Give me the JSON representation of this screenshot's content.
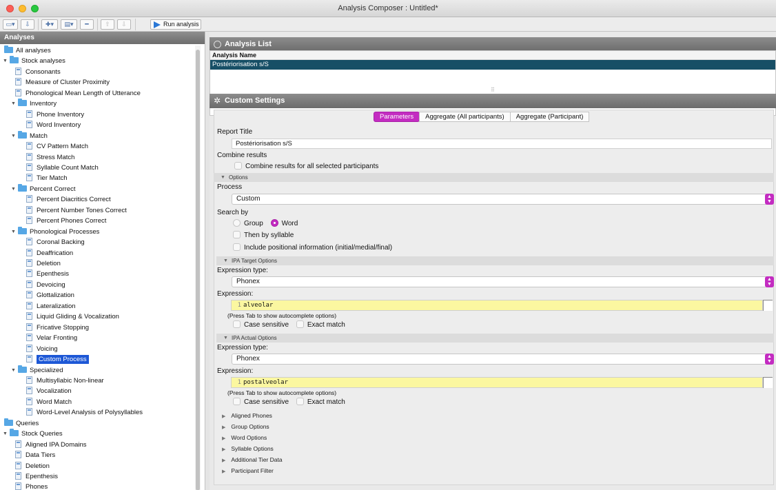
{
  "window": {
    "title": "Analysis Composer : Untitled*"
  },
  "toolbar": {
    "run_label": "Run analysis"
  },
  "left": {
    "header": "Analyses",
    "tree": [
      {
        "label": "All analyses",
        "kind": "folder",
        "level": 0,
        "expanded": false
      },
      {
        "label": "Stock analyses",
        "kind": "folder",
        "level": 1,
        "expanded": true
      },
      {
        "label": "Consonants",
        "kind": "doc",
        "level": 2
      },
      {
        "label": "Measure of Cluster Proximity",
        "kind": "doc",
        "level": 2
      },
      {
        "label": "Phonological Mean Length of Utterance",
        "kind": "doc",
        "level": 2
      },
      {
        "label": "Inventory",
        "kind": "folder",
        "level": 2,
        "expanded": true
      },
      {
        "label": "Phone Inventory",
        "kind": "doc",
        "level": 3
      },
      {
        "label": "Word Inventory",
        "kind": "doc",
        "level": 3
      },
      {
        "label": "Match",
        "kind": "folder",
        "level": 2,
        "expanded": true
      },
      {
        "label": "CV Pattern Match",
        "kind": "doc",
        "level": 3
      },
      {
        "label": "Stress Match",
        "kind": "doc",
        "level": 3
      },
      {
        "label": "Syllable Count Match",
        "kind": "doc",
        "level": 3
      },
      {
        "label": "Tier Match",
        "kind": "doc",
        "level": 3
      },
      {
        "label": "Percent Correct",
        "kind": "folder",
        "level": 2,
        "expanded": true
      },
      {
        "label": "Percent Diacritics Correct",
        "kind": "doc",
        "level": 3
      },
      {
        "label": "Percent Number Tones Correct",
        "kind": "doc",
        "level": 3
      },
      {
        "label": "Percent Phones Correct",
        "kind": "doc",
        "level": 3
      },
      {
        "label": "Phonological Processes",
        "kind": "folder",
        "level": 2,
        "expanded": true
      },
      {
        "label": "Coronal Backing",
        "kind": "doc",
        "level": 3
      },
      {
        "label": "Deaffrication",
        "kind": "doc",
        "level": 3
      },
      {
        "label": "Deletion",
        "kind": "doc",
        "level": 3
      },
      {
        "label": "Epenthesis",
        "kind": "doc",
        "level": 3
      },
      {
        "label": "Devoicing",
        "kind": "doc",
        "level": 3
      },
      {
        "label": "Glottalization",
        "kind": "doc",
        "level": 3
      },
      {
        "label": "Lateralization",
        "kind": "doc",
        "level": 3
      },
      {
        "label": "Liquid Gliding & Vocalization",
        "kind": "doc",
        "level": 3
      },
      {
        "label": "Fricative Stopping",
        "kind": "doc",
        "level": 3
      },
      {
        "label": "Velar Fronting",
        "kind": "doc",
        "level": 3
      },
      {
        "label": "Voicing",
        "kind": "doc",
        "level": 3
      },
      {
        "label": "Custom Process",
        "kind": "doc",
        "level": 3,
        "selected": true
      },
      {
        "label": "Specialized",
        "kind": "folder",
        "level": 2,
        "expanded": true
      },
      {
        "label": "Multisyllabic Non-linear",
        "kind": "doc",
        "level": 3
      },
      {
        "label": "Vocalization",
        "kind": "doc",
        "level": 3
      },
      {
        "label": "Word Match",
        "kind": "doc",
        "level": 3
      },
      {
        "label": "Word-Level Analysis of Polysyllables",
        "kind": "doc",
        "level": 3
      },
      {
        "label": "Queries",
        "kind": "folder",
        "level": 0,
        "expanded": false
      },
      {
        "label": "Stock Queries",
        "kind": "folder",
        "level": 1,
        "expanded": true
      },
      {
        "label": "Aligned IPA Domains",
        "kind": "doc",
        "level": 2
      },
      {
        "label": "Data Tiers",
        "kind": "doc",
        "level": 2
      },
      {
        "label": "Deletion",
        "kind": "doc",
        "level": 2
      },
      {
        "label": "Epenthesis",
        "kind": "doc",
        "level": 2
      },
      {
        "label": "Phones",
        "kind": "doc",
        "level": 2
      }
    ]
  },
  "analysis_list": {
    "header": "Analysis List",
    "column": "Analysis Name",
    "rows": [
      "Postériorisation s/S"
    ]
  },
  "settings": {
    "header": "Custom Settings",
    "tabs": [
      "Parameters",
      "Aggregate (All participants)",
      "Aggregate (Participant)"
    ],
    "active_tab": 0,
    "report_title_label": "Report Title",
    "report_title_value": "Postériorisation s/S",
    "combine_label": "Combine results",
    "combine_checkbox": "Combine results for all selected participants",
    "options_label": "Options",
    "process_label": "Process",
    "process_value": "Custom",
    "search_by_label": "Search by",
    "search_group": "Group",
    "search_word": "Word",
    "then_by_syllable": "Then by syllable",
    "include_positional": "Include positional information (initial/medial/final)",
    "ipa_target_label": "IPA Target Options",
    "ipa_actual_label": "IPA Actual Options",
    "expression_type_label": "Expression type:",
    "expression_type_value": "Phonex",
    "expression_label": "Expression:",
    "target_expression": "alveolar",
    "actual_expression": "postalveolar",
    "line_number": "1",
    "tab_hint": "(Press Tab to show autocomplete options)",
    "case_sensitive": "Case sensitive",
    "exact_match": "Exact match",
    "collapsed_sections": [
      "Aligned Phones",
      "Group Options",
      "Word Options",
      "Syllable Options",
      "Additional Tier Data",
      "Participant Filter"
    ]
  },
  "colors": {
    "accent": "#c32cc1",
    "selection": "#1d58d6",
    "list_selection": "#174f66",
    "expression_bg": "#fbf7a0"
  }
}
